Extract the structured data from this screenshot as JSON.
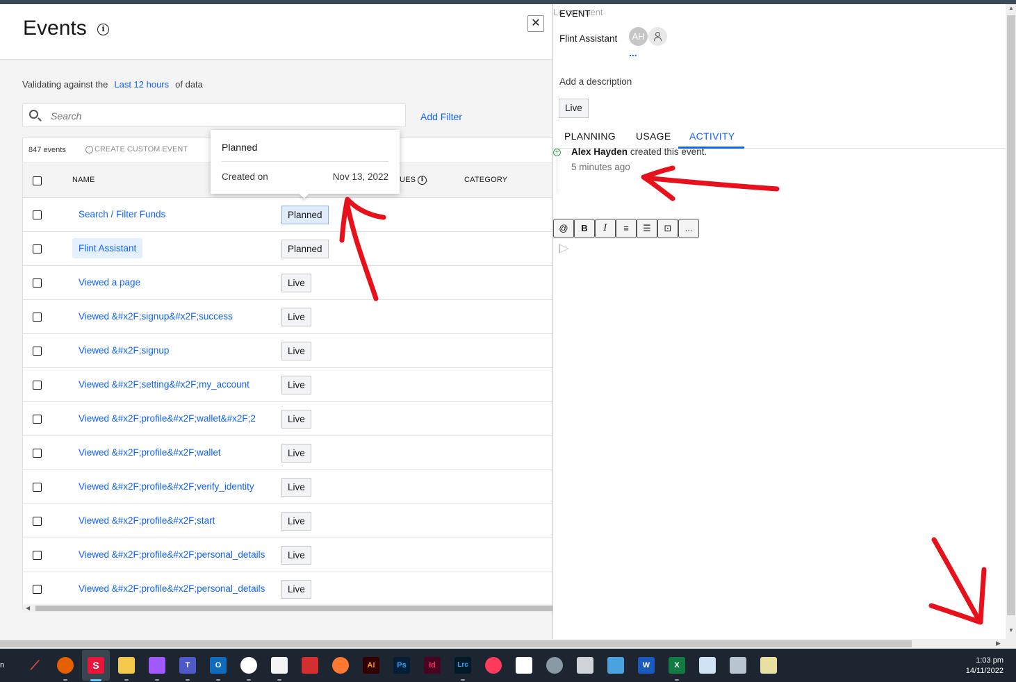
{
  "left": {
    "title": "Events",
    "close_label": "✕",
    "validating_prefix": "Validating against the",
    "validating_link": "Last 12 hours",
    "validating_suffix": "of data",
    "search_placeholder": "Search",
    "add_filter": "Add Filter",
    "event_count": "847 events",
    "create_custom": "CREATE CUSTOM EVENT",
    "columns": {
      "name": "NAME",
      "values": "UES",
      "category": "CATEGORY"
    },
    "rows": [
      {
        "name": "Search / Filter Funds",
        "status": "Planned"
      },
      {
        "name": "Flint Assistant",
        "status": "Planned"
      },
      {
        "name": "Viewed a page",
        "status": "Live"
      },
      {
        "name": "Viewed &#x2F;signup&#x2F;success",
        "status": "Live"
      },
      {
        "name": "Viewed &#x2F;signup",
        "status": "Live"
      },
      {
        "name": "Viewed &#x2F;setting&#x2F;my_account",
        "status": "Live"
      },
      {
        "name": "Viewed &#x2F;profile&#x2F;wallet&#x2F;2",
        "status": "Live"
      },
      {
        "name": "Viewed &#x2F;profile&#x2F;wallet",
        "status": "Live"
      },
      {
        "name": "Viewed &#x2F;profile&#x2F;verify_identity",
        "status": "Live"
      },
      {
        "name": "Viewed &#x2F;profile&#x2F;start",
        "status": "Live"
      },
      {
        "name": "Viewed &#x2F;profile&#x2F;personal_details",
        "status": "Live"
      },
      {
        "name": "Viewed &#x2F;profile&#x2F;personal_details",
        "status": "Live"
      }
    ]
  },
  "tooltip": {
    "title": "Planned",
    "label": "Created on",
    "value": "Nov 13, 2022"
  },
  "right": {
    "overlap_label": "Le    comment",
    "event_label": "EVENT",
    "event_name": "Flint Assistant",
    "avatar_initials": "AH",
    "more": "...",
    "add_description": "Add a description",
    "status": "Live",
    "tabs": [
      "PLANNING",
      "USAGE",
      "ACTIVITY"
    ],
    "active_tab": "ACTIVITY",
    "activity": {
      "user": "Alex Hayden",
      "action": "created this event.",
      "time": "5 minutes ago"
    },
    "editor_buttons": [
      "@",
      "B",
      "I",
      "≡",
      "☰",
      "⊡",
      "..."
    ]
  },
  "taskbar": {
    "time": "1:03 pm",
    "date": "14/11/2022",
    "apps": [
      "Ai",
      "Ps",
      "Id",
      "Lrc"
    ]
  }
}
